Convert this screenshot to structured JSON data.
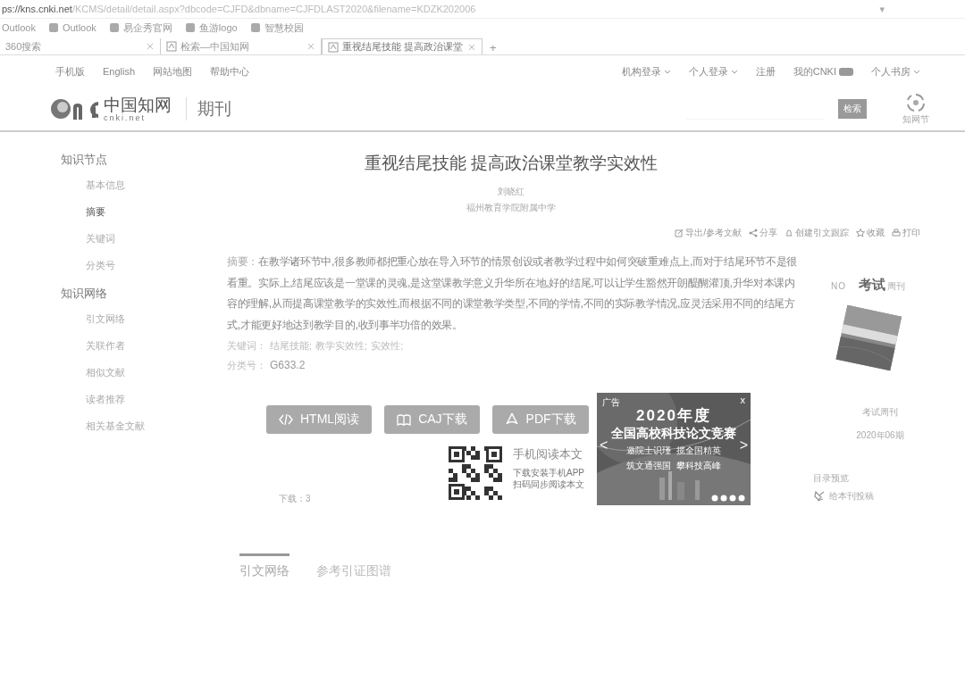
{
  "browser": {
    "address": "ps://kns.cnki.net/KCMS/detail/detail.aspx?dbcode=CJFD&dbname=CJFDLAST2020&filename=KDZK202006",
    "bookmarks": [
      "Outlook",
      "Outlook",
      "易企秀官网",
      "鱼游logo",
      "智慧校园"
    ],
    "tabs": [
      {
        "label": "360搜索",
        "selected": false
      },
      {
        "label": "检索—中国知网",
        "selected": false
      },
      {
        "label": "重视结尾技能 提高政治课堂",
        "selected": true
      }
    ],
    "new_tab": "+",
    "address_caret": "▾"
  },
  "top_nav": {
    "left": [
      "手机版",
      "English",
      "网站地图",
      "帮助中心"
    ],
    "right": [
      {
        "label": "机构登录",
        "dropdown": true
      },
      {
        "label": "个人登录",
        "dropdown": true
      },
      {
        "label": "注册",
        "dropdown": false
      },
      {
        "label": "我的CNKI",
        "dropdown": false
      },
      {
        "label": "个人书房",
        "dropdown": true
      }
    ]
  },
  "header": {
    "logo_cn": "中国知网",
    "logo_en": "cnki.net",
    "section": "期刊",
    "search_button": "检索",
    "side_label": "知网节"
  },
  "sidebar": {
    "groups": [
      {
        "title": "知识节点",
        "items": [
          {
            "label": "基本信息",
            "selected": false
          },
          {
            "label": "摘要",
            "selected": true
          },
          {
            "label": "关键词",
            "selected": false
          },
          {
            "label": "分类号",
            "selected": false
          }
        ]
      },
      {
        "title": "知识网络",
        "items": [
          {
            "label": "引文网络",
            "selected": false
          },
          {
            "label": "关联作者",
            "selected": false
          },
          {
            "label": "相似文献",
            "selected": false
          },
          {
            "label": "读者推荐",
            "selected": false
          },
          {
            "label": "相关基金文献",
            "selected": false
          }
        ]
      }
    ]
  },
  "article": {
    "title": "重视结尾技能 提高政治课堂教学实效性",
    "author": "刘晓红",
    "affiliation": "福州教育学院附属中学",
    "tools": [
      {
        "label": "导出/参考文献",
        "kind": "export"
      },
      {
        "label": "分享",
        "kind": "share"
      },
      {
        "label": "创建引文跟踪",
        "kind": "bell"
      },
      {
        "label": "收藏",
        "kind": "star"
      },
      {
        "label": "打印",
        "kind": "print"
      }
    ],
    "abstract_label": "摘要：",
    "abstract": "在教学诸环节中,很多教师都把重心放在导入环节的情景创设或者教学过程中如何突破重难点上,而对于结尾环节不是很看重。实际上,结尾应该是一堂课的灵魂,是这堂课教学意义升华所在地,好的结尾,可以让学生豁然开朗醍醐灌顶,升华对本课内容的理解,从而提高课堂教学的实效性,而根据不同的课堂教学类型,不同的学情,不同的实际教学情况,应灵活采用不同的结尾方式,才能更好地达到教学目的,收到事半功倍的效果。",
    "keywords_label": "关键词：",
    "keywords": [
      "结尾技能;",
      "教学实效性;",
      "实效性;"
    ],
    "class_label": "分类号：",
    "class_code": "G633.2",
    "buttons": [
      {
        "label": "HTML阅读",
        "kind": "html"
      },
      {
        "label": "CAJ下载",
        "kind": "caj"
      },
      {
        "label": "PDF下载",
        "kind": "pdf"
      }
    ],
    "downloads": "下载：3",
    "mobile": {
      "title": "手机阅读本文",
      "lines": [
        "下载安装手机APP",
        "扫码同步阅读本文"
      ]
    },
    "ad": {
      "tag": "广告",
      "close": "x",
      "year": "2020年度",
      "headline": "全国高校科技论文竞赛",
      "lines": [
        "邀院士识瑾  揽全国精英",
        "筑文通强国  攀科技高峰"
      ],
      "prev": "<",
      "next": ">"
    },
    "bottom_tabs": [
      {
        "label": "引文网络",
        "selected": true
      },
      {
        "label": "参考引证图谱",
        "selected": false
      }
    ]
  },
  "journal": {
    "cover": {
      "kind": "picture",
      "mark": "NO",
      "name": "考试",
      "sub": "周刊"
    },
    "name": "考试周刊",
    "issue": "2020年06期",
    "preview": "目录预览",
    "submit": "给本刊投稿"
  }
}
